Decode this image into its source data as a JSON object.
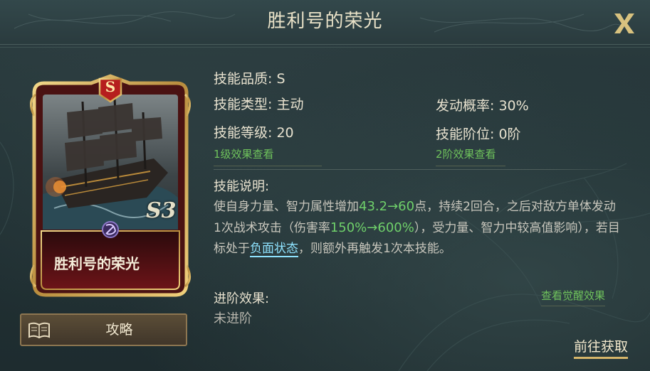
{
  "header": {
    "title": "胜利号的荣光",
    "close_label": "X"
  },
  "card": {
    "grade_letter": "S",
    "name": "胜利号的荣光",
    "level_text": "S3",
    "emblem_icon": "hammer-sickle-icon",
    "art": "sailing-warship-image"
  },
  "guide": {
    "label": "攻略",
    "icon": "book-icon"
  },
  "skill": {
    "quality": "技能品质: S",
    "type": "技能类型: 主动",
    "trigger_rate": "发动概率: 30%",
    "level": "技能等级: 20",
    "tier": "技能阶位: 0阶",
    "level1_link": "1级效果查看",
    "tier2_link": "2阶效果查看",
    "desc_title": "技能说明:",
    "desc_parts": {
      "p1": "使自身力量、智力属性增加",
      "v1": "43.2→60",
      "p2": "点，持续2回合，之后对敌方单体发动1次战术攻击（伤害率",
      "v2": "150%→600%",
      "p3": "），受力量、智力中较高值影响），若目标处于",
      "neg": "负面状态",
      "p4": "，则额外再触发1次本技能。"
    },
    "advance_title": "进阶效果:",
    "advance_value": "未进阶",
    "awakening_link": "查看觉醒效果"
  },
  "footer": {
    "obtain_label": "前往获取"
  },
  "colors": {
    "accent_green": "#6fc35c",
    "value_green": "#6fd06a",
    "status_cyan": "#8fe3ff",
    "gold": "#d6b66a"
  }
}
